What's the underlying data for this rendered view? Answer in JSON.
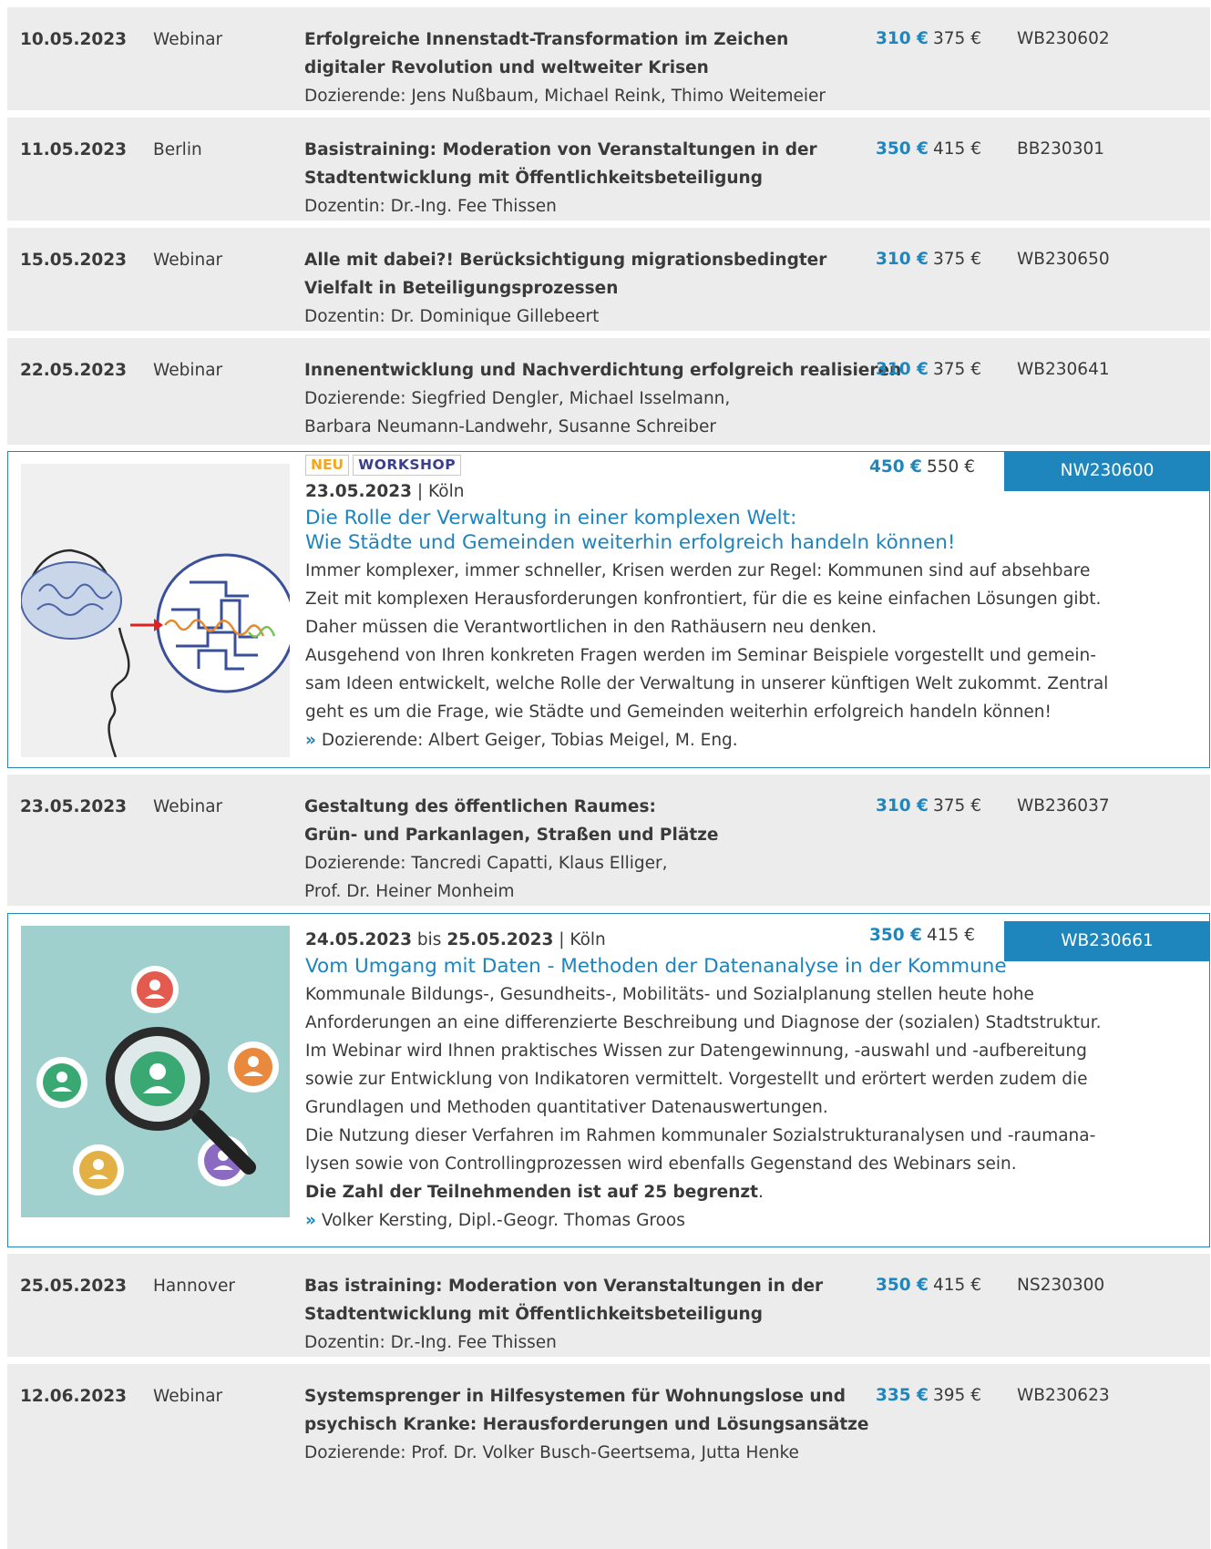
{
  "rows": [
    {
      "date": "10.05.2023",
      "location": "Webinar",
      "title": [
        "Erfolgreiche Innenstadt-Transformation im Zeichen",
        "digitaler Revolution und weltweiter Krisen"
      ],
      "lecturers": [
        "Dozierende: Jens Nußbaum, Michael Reink, Thimo Weitemeier"
      ],
      "price_new": "310 €",
      "price_old": "375 €",
      "code": "WB230602"
    },
    {
      "date": "11.05.2023",
      "location": "Berlin",
      "title": [
        "Basistraining: Moderation von Veranstaltungen in der",
        "Stadtentwicklung mit Öffentlichkeitsbeteiligung"
      ],
      "lecturers": [
        "Dozentin: Dr.-Ing. Fee Thissen"
      ],
      "price_new": "350 €",
      "price_old": "415 €",
      "code": "BB230301"
    },
    {
      "date": "15.05.2023",
      "location": "Webinar",
      "title": [
        "Alle mit dabei?! Berücksichtigung migrationsbedingter",
        "Vielfalt in Beteiligungsprozessen"
      ],
      "lecturers": [
        "Dozentin: Dr. Dominique Gillebeert"
      ],
      "price_new": "310 €",
      "price_old": "375 €",
      "code": "WB230650"
    },
    {
      "date": "22.05.2023",
      "location": "Webinar",
      "title": [
        "Innenentwicklung und Nachverdichtung erfolgreich realisieren"
      ],
      "lecturers": [
        "Dozierende: Siegfried Dengler, Michael Isselmann,",
        "Barbara Neumann-Landwehr, Susanne Schreiber"
      ],
      "price_new": "310 €",
      "price_old": "375 €",
      "code": "WB230641"
    },
    {
      "date": "23.05.2023",
      "location": "Webinar",
      "title": [
        "Gestaltung des öffentlichen Raumes:",
        "Grün- und Parkanlagen, Straßen und Plätze"
      ],
      "lecturers": [
        "Dozierende: Tancredi Capatti, Klaus Elliger,",
        "Prof. Dr. Heiner Monheim"
      ],
      "price_new": "310 €",
      "price_old": "375 €",
      "code": "WB236037"
    },
    {
      "date": "25.05.2023",
      "location": "Hannover",
      "title": [
        "Bas istraining: Moderation von Veranstaltungen in der",
        "Stadtentwicklung mit Öffentlichkeitsbeteiligung"
      ],
      "lecturers": [
        "Dozentin: Dr.-Ing. Fee Thissen"
      ],
      "price_new": "350 €",
      "price_old": "415 €",
      "code": "NS230300"
    },
    {
      "date": "12.06.2023",
      "location": "Webinar",
      "title": [
        "Systemsprenger in Hilfesystemen für Wohnungslose und",
        "psychisch Kranke: Herausforderungen und Lösungsansätze"
      ],
      "lecturers": [
        "Dozierende: Prof. Dr. Volker Busch-Geertsema, Jutta Henke"
      ],
      "price_new": "335 €",
      "price_old": "395 €",
      "code": "WB230623"
    }
  ],
  "feature1": {
    "tag_new": "NEU",
    "tag_workshop": "WORKSHOP",
    "date": "23.05.2023",
    "sep": " | ",
    "city": "Köln",
    "title": [
      "Die Rolle der Verwaltung in einer komplexen Welt:",
      "Wie Städte und Gemeinden weiterhin erfolgreich handeln können!"
    ],
    "desc": [
      "Immer komplexer, immer schneller, Krisen werden zur Regel: Kommunen sind auf absehbare",
      "Zeit mit komplexen Herausforderungen konfrontiert, für die es keine einfachen Lösungen gibt.",
      "Daher müssen die Verantwortlichen in den Rathäusern neu denken.",
      "Ausgehend von Ihren konkreten Fragen werden im Seminar Beispiele vorgestellt und gemein-",
      "sam Ideen entwickelt, welche Rolle der Verwaltung in unserer künftigen Welt zukommt. Zentral",
      "geht es um die Frage, wie Städte und Gemeinden weiterhin erfolgreich handeln können!"
    ],
    "arrow": "»",
    "lecturers": "Dozierende: Albert Geiger, Tobias Meigel, M. Eng.",
    "price_new": "450 €",
    "price_old": "550 €",
    "code": "NW230600"
  },
  "feature2": {
    "date_from": "24.05.2023",
    "bis": " bis ",
    "date_to": "25.05.2023",
    "sep": " | ",
    "city": "Köln",
    "title": "Vom Umgang mit Daten - Methoden der Datenanalyse in der Kommune",
    "desc": [
      "Kommunale Bildungs-, Gesundheits-, Mobilitäts- und Sozialplanung stellen heute hohe",
      "Anforderungen an eine differenzierte Beschreibung und Diagnose der (sozialen) Stadtstruktur.",
      "Im Webinar wird Ihnen praktisches Wissen zur Datengewinnung, -auswahl und -aufbereitung",
      "sowie zur Entwicklung von Indikatoren vermittelt. Vorgestellt und erörtert werden zudem die",
      "Grundlagen und Methoden quantitativer Datenauswertungen.",
      "Die Nutzung dieser Verfahren im Rahmen kommunaler Sozialstrukturanalysen und -raumana-",
      "lysen sowie von Controllingprozessen wird ebenfalls Gegenstand des Webinars sein."
    ],
    "limit": "Die Zahl der Teilnehmenden ist auf 25 begrenzt",
    "limit_dot": ".",
    "arrow": "»",
    "lecturers": "Volker Kersting, Dipl.-Geogr. Thomas Groos",
    "price_new": "350 €",
    "price_old": "415 €",
    "code": "WB230661"
  }
}
